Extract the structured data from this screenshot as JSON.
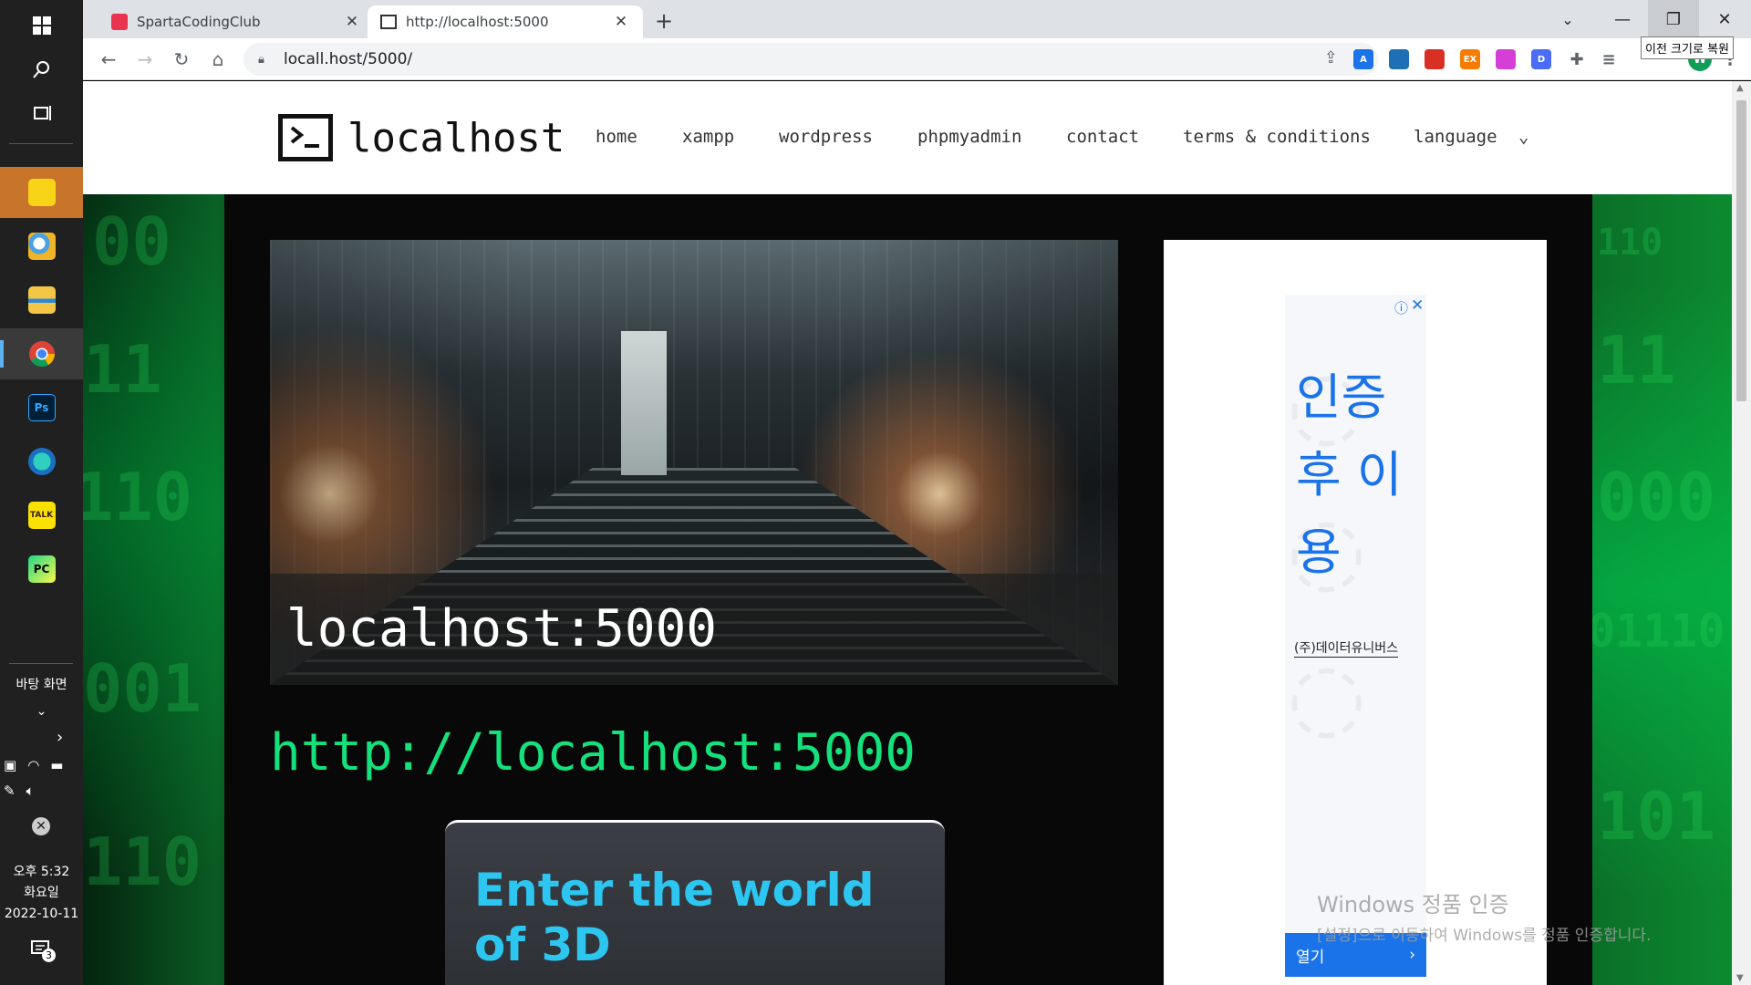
{
  "taskbar": {
    "desktop_label": "바탕 화면",
    "time": "오후 5:32",
    "day": "화요일",
    "date": "2022-10-11",
    "notification_count": "3",
    "apps": [
      "sticky-notes",
      "paint",
      "file-explorer",
      "chrome",
      "photoshop",
      "app",
      "kakaotalk",
      "pycharm"
    ],
    "ps_label": "Ps",
    "talk_label": "TALK",
    "pc_label": "PC"
  },
  "browser": {
    "tabs": [
      {
        "title": "SpartaCodingClub",
        "active": false
      },
      {
        "title": "http://localhost:5000",
        "active": true
      }
    ],
    "address": "locall.host/5000/",
    "tooltip": "이전 크기로 복원",
    "profile_initial": "W",
    "extensions": [
      "A",
      "",
      "",
      "EX",
      "",
      "D"
    ]
  },
  "site": {
    "logo_text": "localhost",
    "nav": [
      "home",
      "xampp",
      "wordpress",
      "phpmyadmin",
      "contact",
      "terms & conditions",
      "language"
    ],
    "featured_title": "localhost:5000",
    "url_heading": "http://localhost:5000",
    "card_title": "Enter the world of 3D"
  },
  "ad": {
    "headline": "인증 후 이용",
    "brand": "(주)데이터유니버스",
    "open_label": "열기"
  },
  "activation": {
    "line1": "Windows 정품 인증",
    "line2": "[설정]으로 이동하여 Windows를 정품 인증합니다."
  },
  "colors": {
    "accent_green": "#14e07c",
    "card_title": "#2cc6f0",
    "ad_blue": "#1a73e8"
  }
}
